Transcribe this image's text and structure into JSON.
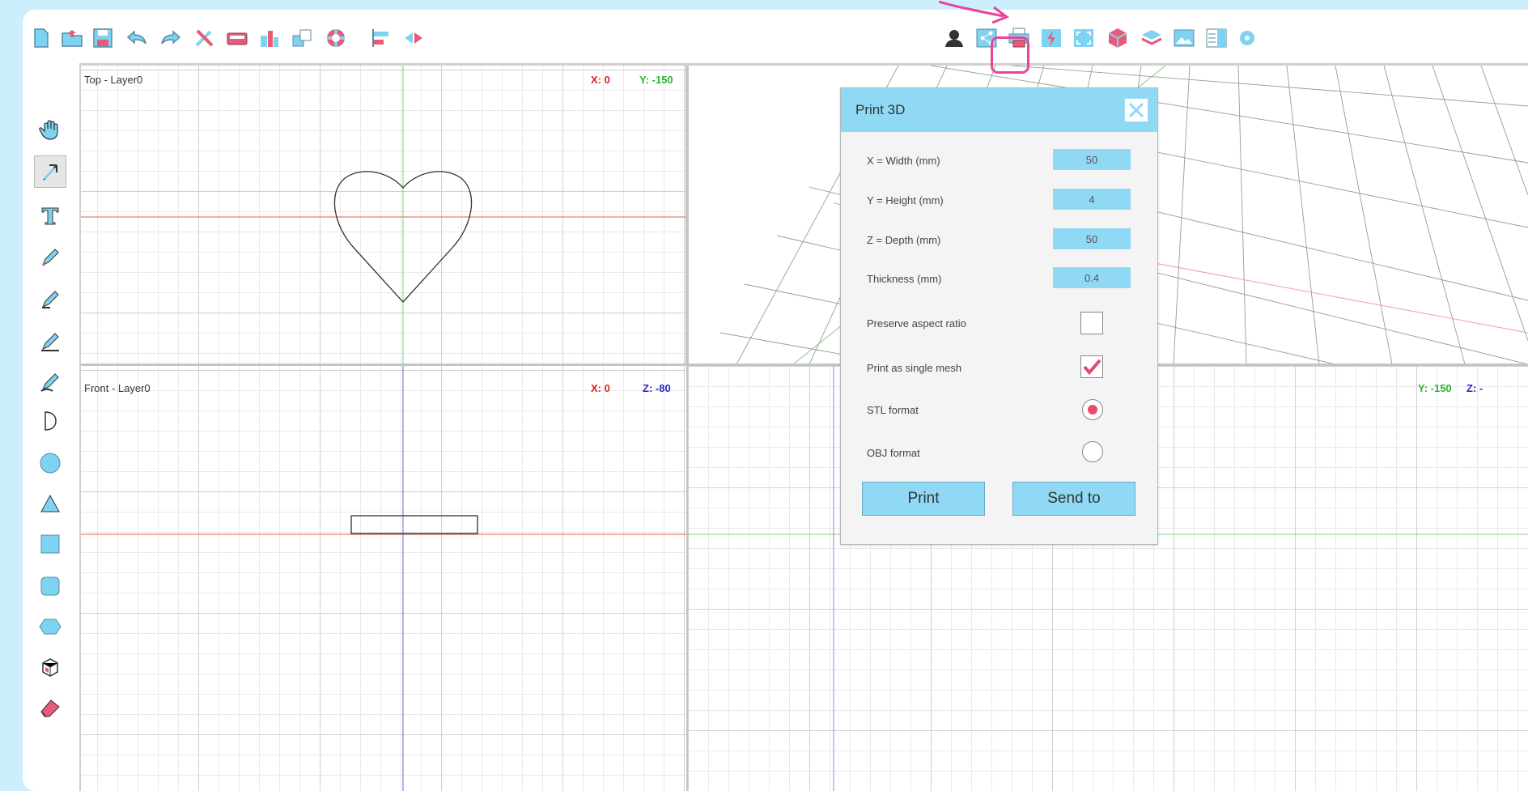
{
  "toolbar": {
    "left_icons": [
      "new-file-icon",
      "open-folder-icon",
      "save-icon",
      "undo-icon",
      "redo-icon",
      "tools-icon",
      "keyboard-icon",
      "image-icon",
      "group-icon",
      "lifebuoy-icon",
      "align-icon",
      "mirror-icon"
    ],
    "right_icons": [
      "user-icon",
      "share-icon",
      "print-3d-icon",
      "lightning-icon",
      "fullscreen-icon",
      "cube-icon",
      "layers-icon",
      "picture-icon",
      "panel-icon"
    ]
  },
  "sidebar": {
    "tools": [
      "hand-tool",
      "select-tool",
      "text-tool",
      "pencil-tool",
      "pen-tool",
      "line-tool",
      "curve-tool",
      "half-circle-tool",
      "circle-tool",
      "triangle-tool",
      "square-tool",
      "rounded-square-tool",
      "hexagon-tool",
      "box-tool",
      "eraser-tool"
    ]
  },
  "viewports": {
    "top": {
      "label": "Top - Layer0",
      "x": "X: 0",
      "y": "Y: -150"
    },
    "front": {
      "label": "Front - Layer0",
      "x": "X: 0",
      "z": "Z: -80"
    },
    "side": {
      "y": "Y: -150",
      "z": "Z: -"
    }
  },
  "dialog": {
    "title": "Print 3D",
    "fields": [
      {
        "label": "X = Width (mm)",
        "value": "50"
      },
      {
        "label": "Y = Height (mm)",
        "value": "4"
      },
      {
        "label": "Z = Depth (mm)",
        "value": "50"
      },
      {
        "label": "Thickness (mm)",
        "value": "0.4"
      }
    ],
    "options": {
      "preserve_aspect": {
        "label": "Preserve aspect ratio",
        "checked": false
      },
      "single_mesh": {
        "label": "Print as single mesh",
        "checked": true
      },
      "stl": {
        "label": "STL format",
        "selected": true
      },
      "obj": {
        "label": "OBJ format",
        "selected": false
      }
    },
    "print_label": "Print",
    "send_label": "Send to"
  },
  "colors": {
    "accent": "#8fd9f5",
    "highlight": "#e8459a",
    "model": "#22cc22",
    "x_axis": "#e02020",
    "y_axis": "#2ab52a",
    "z_axis": "#2828c8"
  }
}
